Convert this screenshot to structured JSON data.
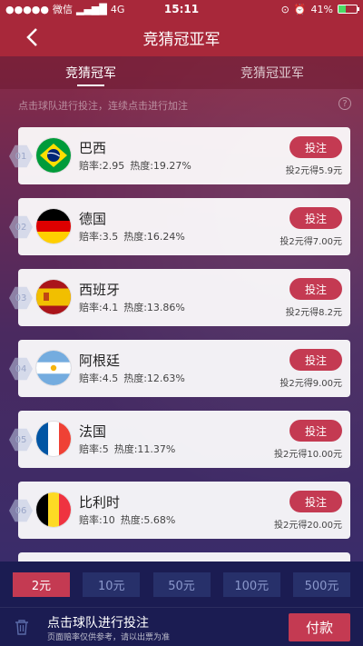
{
  "status_bar": {
    "carrier": "微信",
    "network": "4G",
    "time": "15:11",
    "battery": "41%",
    "battery_level": 0.41
  },
  "nav": {
    "title": "竞猜冠亚军"
  },
  "tabs": [
    {
      "label": "竞猜冠军",
      "active": true
    },
    {
      "label": "竞猜冠亚军",
      "active": false
    }
  ],
  "hint": "点击球队进行投注，连续点击进行加注",
  "help_icon": "?",
  "teams": [
    {
      "rank": "01",
      "name": "巴西",
      "odds": "赔率:2.95",
      "heat": "热度:19.27%",
      "bet_label": "投注",
      "payout": "投2元得5.9元",
      "flag": "brazil"
    },
    {
      "rank": "02",
      "name": "德国",
      "odds": "赔率:3.5",
      "heat": "热度:16.24%",
      "bet_label": "投注",
      "payout": "投2元得7.00元",
      "flag": "germany"
    },
    {
      "rank": "03",
      "name": "西班牙",
      "odds": "赔率:4.1",
      "heat": "热度:13.86%",
      "bet_label": "投注",
      "payout": "投2元得8.2元",
      "flag": "spain"
    },
    {
      "rank": "04",
      "name": "阿根廷",
      "odds": "赔率:4.5",
      "heat": "热度:12.63%",
      "bet_label": "投注",
      "payout": "投2元得9.00元",
      "flag": "argentina"
    },
    {
      "rank": "05",
      "name": "法国",
      "odds": "赔率:5",
      "heat": "热度:11.37%",
      "bet_label": "投注",
      "payout": "投2元得10.00元",
      "flag": "france"
    },
    {
      "rank": "06",
      "name": "比利时",
      "odds": "赔率:10",
      "heat": "热度:5.68%",
      "bet_label": "投注",
      "payout": "投2元得20.00元",
      "flag": "belgium"
    }
  ],
  "amounts": [
    {
      "label": "2元",
      "selected": true
    },
    {
      "label": "10元",
      "selected": false
    },
    {
      "label": "50元",
      "selected": false
    },
    {
      "label": "100元",
      "selected": false
    },
    {
      "label": "500元",
      "selected": false
    }
  ],
  "footer": {
    "title": "点击球队进行投注",
    "note": "页面赔率仅供参考，请以出票为准",
    "pay_label": "付款"
  },
  "colors": {
    "header": "#a8283a",
    "accent": "#c43a52",
    "footer": "#1b1c52"
  }
}
